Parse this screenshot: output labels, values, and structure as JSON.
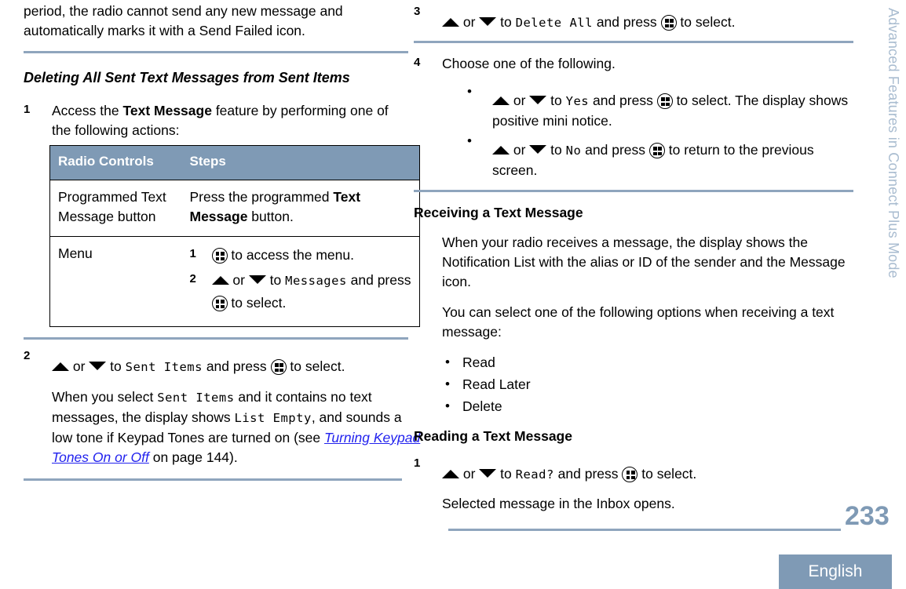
{
  "document": {
    "page_number": "233",
    "language_badge": "English",
    "side_tab": "Advanced Features in Connect Plus Mode"
  },
  "icons": {
    "menu": "menu-button-icon",
    "up": "up-arrow-icon",
    "down": "down-arrow-icon"
  },
  "colors": {
    "accent": "#7f9ab5",
    "rule": "#8fa5bd",
    "link": "#2222ee",
    "side_tab": "#a9bcd0"
  },
  "left_column": {
    "continued_paragraph": "period, the radio cannot send any new message and automatically marks it with a Send Failed icon.",
    "heading": "Deleting All Sent Text Messages from Sent Items",
    "step1": {
      "number": "1",
      "text_before": "Access the ",
      "bold": "Text Message",
      "text_after": " feature by performing one of the following actions:"
    },
    "table": {
      "headers": [
        "Radio Controls",
        "Steps"
      ],
      "rows": [
        {
          "control": "Programmed Text Message button",
          "steps_text_before": "Press the programmed ",
          "steps_bold": "Text Message",
          "steps_text_after": " button."
        }
      ],
      "menu_row": {
        "control": "Menu",
        "substeps": [
          {
            "number": "1",
            "icon": "menu",
            "text": " to access the menu."
          },
          {
            "number": "2",
            "prefix": " or ",
            "mid": " to ",
            "lcd": "Messages",
            "suffix": " and press ",
            "tail": " to select."
          }
        ]
      }
    },
    "step2": {
      "number": "2",
      "prefix": " or ",
      "mid": " to ",
      "lcd": "Sent Items",
      "suffix": " and press ",
      "tail": " to select."
    },
    "note": {
      "p1": "When you select ",
      "lcd1": "Sent Items",
      "p2": " and it contains no text messages, the display shows ",
      "lcd2": "List Empty",
      "p3": ", and sounds a low tone if Keypad Tones are turned on (see ",
      "link": "Turning Keypad Tones On or Off",
      "p4": " on page 144)."
    }
  },
  "right_column": {
    "step3": {
      "number": "3",
      "prefix": " or ",
      "mid": " to ",
      "lcd": "Delete All",
      "suffix": " and press ",
      "tail": " to select."
    },
    "step4": {
      "number": "4",
      "text": "Choose one of the following.",
      "bullets": [
        {
          "prefix": " or ",
          "mid": " to ",
          "lcd": "Yes",
          "suffix": " and press ",
          "tail": " to select. The display shows positive mini notice."
        },
        {
          "prefix": " or ",
          "mid": " to ",
          "lcd": "No",
          "suffix": " and press ",
          "tail": " to return to the previous screen."
        }
      ]
    },
    "receiving": {
      "heading": "Receiving a Text Message",
      "p1": "When your radio receives a message, the display shows the Notification List with the alias or ID of the sender and the Message icon.",
      "p2": "You can select one of the following options when receiving a text message:",
      "options": [
        "Read",
        "Read Later",
        "Delete"
      ]
    },
    "reading": {
      "heading": "Reading a Text Message",
      "step1": {
        "number": "1",
        "prefix": " or ",
        "mid": " to ",
        "lcd": "Read?",
        "suffix": " and press ",
        "tail": " to select."
      },
      "result": "Selected message in the Inbox opens."
    }
  }
}
